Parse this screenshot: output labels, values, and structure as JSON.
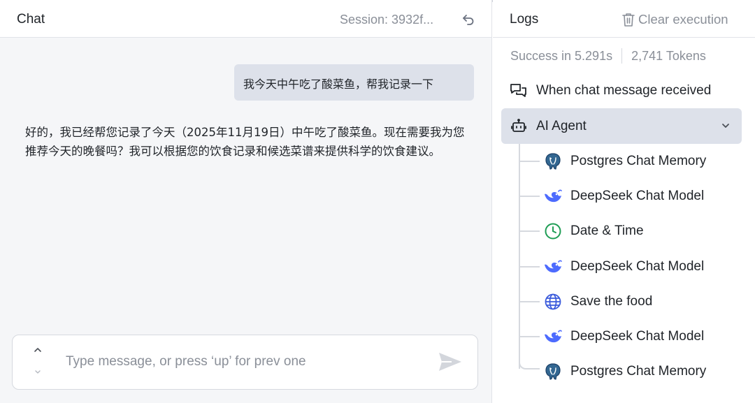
{
  "chat": {
    "title": "Chat",
    "session": "Session: 3932f...",
    "messages": [
      {
        "role": "user",
        "text": "我今天中午吃了酸菜鱼，帮我记录一下"
      },
      {
        "role": "assistant",
        "text": "好的，我已经帮您记录了今天（2025年11月19日）中午吃了酸菜鱼。现在需要我为您推荐今天的晚餐吗？我可以根据您的饮食记录和候选菜谱来提供科学的饮食建议。"
      }
    ],
    "input": {
      "placeholder": "Type message, or press ‘up’ for prev one",
      "value": ""
    }
  },
  "logs": {
    "title": "Logs",
    "clear_label": "Clear execution",
    "status": {
      "success": "Success in 5.291s",
      "tokens": "2,741 Tokens"
    },
    "trigger": {
      "label": "When chat message received",
      "icon": "chat-bubbles-icon"
    },
    "agent": {
      "label": "AI Agent",
      "icon": "robot-icon",
      "expanded": true
    },
    "children": [
      {
        "label": "Postgres Chat Memory",
        "icon": "postgres-icon"
      },
      {
        "label": "DeepSeek Chat Model",
        "icon": "deepseek-icon"
      },
      {
        "label": "Date & Time",
        "icon": "clock-icon"
      },
      {
        "label": "DeepSeek Chat Model",
        "icon": "deepseek-icon"
      },
      {
        "label": "Save the food",
        "icon": "globe-icon"
      },
      {
        "label": "DeepSeek Chat Model",
        "icon": "deepseek-icon"
      },
      {
        "label": "Postgres Chat Memory",
        "icon": "postgres-icon"
      }
    ]
  },
  "colors": {
    "selected_bg": "#dde1ea",
    "muted_text": "#8a8f98",
    "deepseek_blue": "#4d6bfe",
    "clock_green": "#1f9d55",
    "globe_blue": "#3b5bdb",
    "postgres_blue": "#336791"
  }
}
